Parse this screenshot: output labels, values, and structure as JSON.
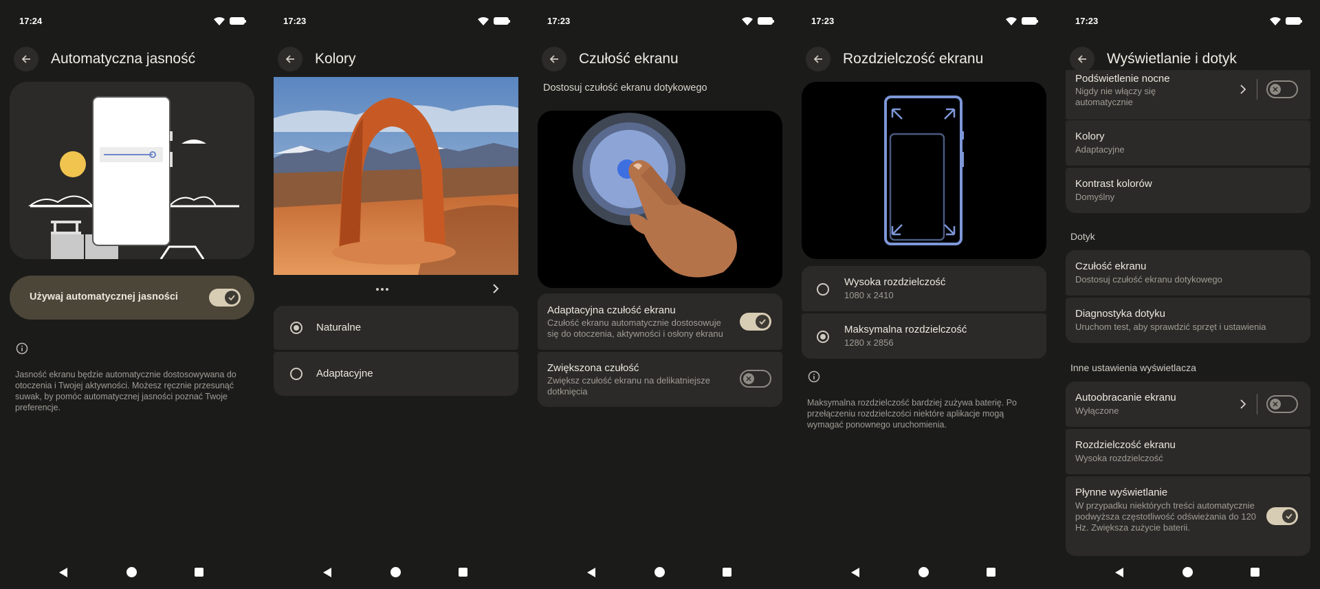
{
  "screens": [
    {
      "time": "17:24",
      "title": "Automatyczna jasność",
      "toggle_label": "Używaj automatycznej jasności",
      "info_text": "Jasność ekranu będzie automatycznie dostosowywana do otoczenia i Twojej aktywności. Możesz ręcznie przesunąć suwak, by pomóc automatycznej jasności poznać Twoje preferencje."
    },
    {
      "time": "17:23",
      "title": "Kolory",
      "options": [
        {
          "label": "Naturalne",
          "selected": true
        },
        {
          "label": "Adaptacyjne",
          "selected": false
        }
      ]
    },
    {
      "time": "17:23",
      "title": "Czułość ekranu",
      "subtitle": "Dostosuj czułość ekranu dotykowego",
      "items": [
        {
          "title": "Adaptacyjna czułość ekranu",
          "sub": "Czułość ekranu automatycznie dostosowuje się do otoczenia, aktywności i osłony ekranu",
          "on": true
        },
        {
          "title": "Zwiększona czułość",
          "sub": "Zwiększ czułość ekranu na delikatniejsze dotknięcia",
          "on": false
        }
      ]
    },
    {
      "time": "17:23",
      "title": "Rozdzielczość ekranu",
      "options": [
        {
          "label": "Wysoka rozdzielczość",
          "sub": "1080 x 2410",
          "selected": false
        },
        {
          "label": "Maksymalna rozdzielczość",
          "sub": "1280 x 2856",
          "selected": true
        }
      ],
      "info_text": "Maksymalna rozdzielczość bardziej zużywa baterię. Po przełączeniu rozdzielczości niektóre aplikacje mogą wymagać ponownego uruchomienia."
    },
    {
      "time": "17:23",
      "title": "Wyświetlanie i dotyk",
      "display_items": [
        {
          "title": "Podświetlenie nocne",
          "sub": "Nigdy nie włączy się automatycznie"
        },
        {
          "title": "Kolory",
          "sub": "Adaptacyjne"
        },
        {
          "title": "Kontrast kolorów",
          "sub": "Domyślny"
        }
      ],
      "touch_label": "Dotyk",
      "touch_items": [
        {
          "title": "Czułość ekranu",
          "sub": "Dostosuj czułość ekranu dotykowego"
        },
        {
          "title": "Diagnostyka dotyku",
          "sub": "Uruchom test, aby sprawdzić sprzęt i ustawienia"
        }
      ],
      "other_label": "Inne ustawienia wyświetlacza",
      "other_items": [
        {
          "title": "Autoobracanie ekranu",
          "sub": "Wyłączone"
        },
        {
          "title": "Rozdzielczość ekranu",
          "sub": "Wysoka rozdzielczość"
        },
        {
          "title": "Płynne wyświetlanie",
          "sub": "W przypadku niektórych treści automatycznie podwyższa częstotliwość odświeżania do 120 Hz. Zwiększa zużycie baterii."
        }
      ]
    }
  ],
  "colors": {
    "background": "#1b1b1a",
    "card": "#2b2a28",
    "toggle_on": "#d7ccb4",
    "accent_blue": "#7d97d8"
  }
}
